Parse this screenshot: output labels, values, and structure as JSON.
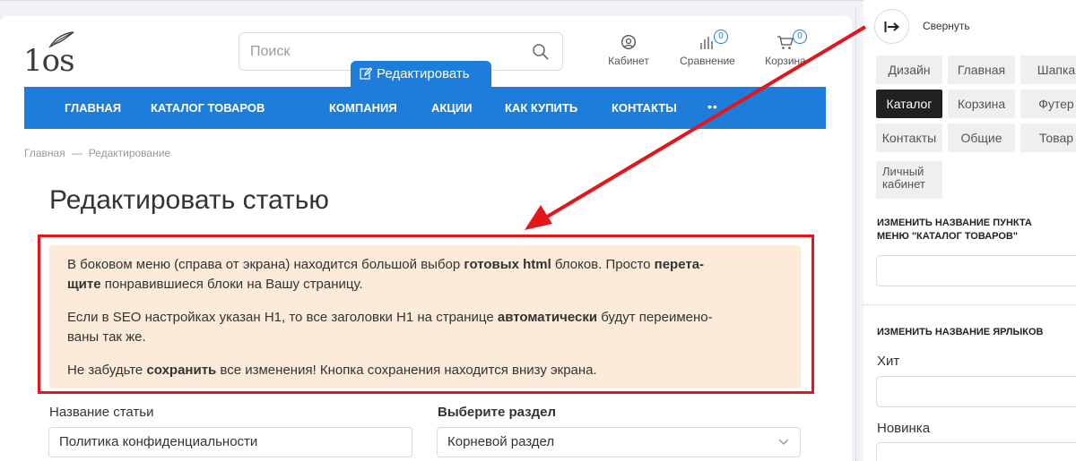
{
  "logo": {
    "text": "1os"
  },
  "search": {
    "placeholder": "Поиск"
  },
  "header": {
    "cabinet": {
      "label": "Кабинет"
    },
    "compare": {
      "label": "Сравнение",
      "count": "0"
    },
    "cart": {
      "label": "Корзина",
      "count": "0"
    }
  },
  "edit_button": {
    "label": "Редактировать"
  },
  "nav": {
    "items": [
      "ГЛАВНАЯ",
      "КАТАЛОГ ТОВАРОВ",
      "КОМПАНИЯ",
      "АКЦИИ",
      "КАК КУПИТЬ",
      "КОНТАКТЫ"
    ],
    "more": "••"
  },
  "breadcrumb": {
    "home": "Главная",
    "sep": "—",
    "current": "Редактирование"
  },
  "page": {
    "title": "Редактировать статью"
  },
  "info": {
    "p1a": "В боковом меню (справа от экрана) находится большой выбор ",
    "p1b": "готовых html",
    "p1c": " блоков. Просто ",
    "p1d": "перета-",
    "p1e": "щите",
    "p1f": " понравившиеся блоки на Вашу страницу.",
    "p2a": "Если в SEO настройках указан H1, то все заголовки H1 на странице ",
    "p2b": "автоматически",
    "p2c": " будут переимено-",
    "p2d": "ваны так же.",
    "p3a": "Не забудьте ",
    "p3b": "сохранить",
    "p3c": " все изменения! Кнопка сохранения находится внизу экрана."
  },
  "form": {
    "name_label": "Название статьи",
    "name_value": "Политика конфиденциальности",
    "section_label": "Выберите раздел",
    "section_value": "Корневой раздел"
  },
  "panel": {
    "collapse": "Свернуть",
    "tabs": [
      "Дизайн",
      "Главная",
      "Шапка",
      "Каталог",
      "Корзина",
      "Футер",
      "Контакты",
      "Общие",
      "Товар"
    ],
    "tab_lk_1": "Личный",
    "tab_lk_2": "кабинет",
    "active_tab": "Каталог",
    "section1_line1": "ИЗМЕНИТЬ НАЗВАНИЕ ПУНКТА",
    "section1_line2": "МЕНЮ \"КАТАЛОГ ТОВАРОВ\"",
    "section2": "ИЗМЕНИТЬ НАЗВАНИЕ ЯРЛЫКОВ",
    "label_hit": "Хит",
    "label_new": "Новинка"
  },
  "colors": {
    "accent": "#1e7ddb",
    "highlight": "#e3161b",
    "info_bg": "#fcebd8",
    "active_tab": "#212121"
  }
}
